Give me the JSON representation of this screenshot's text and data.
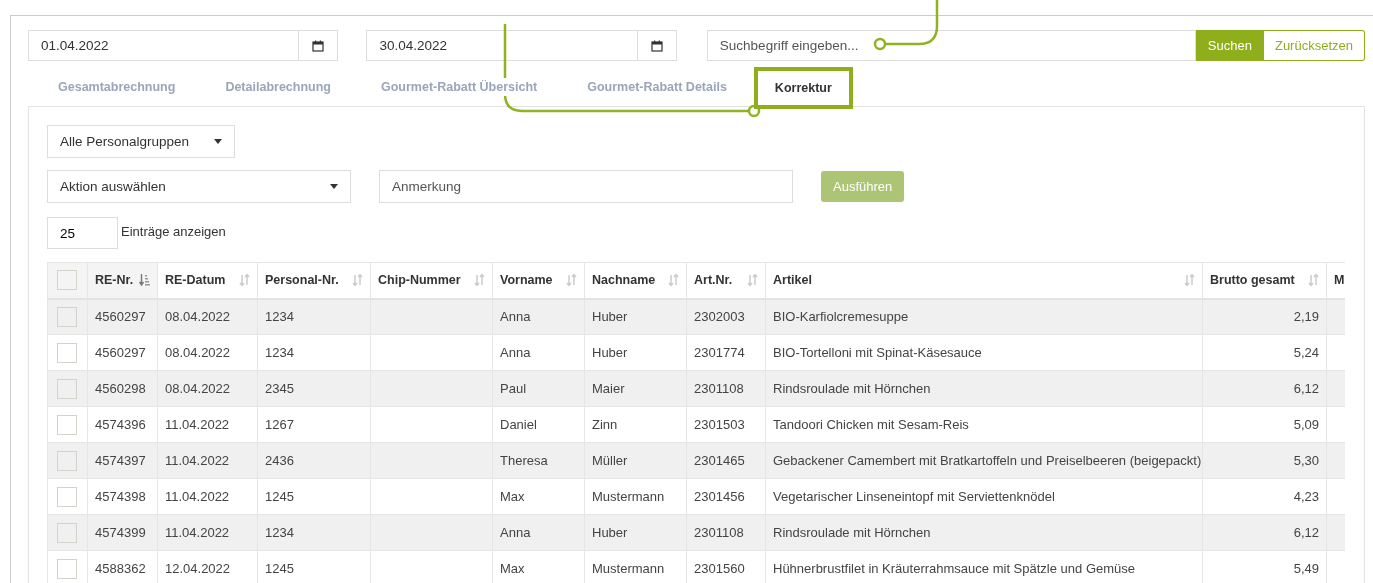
{
  "date_from": {
    "value": "01.04.2022"
  },
  "date_to": {
    "value": "30.04.2022"
  },
  "search": {
    "placeholder": "Suchbegriff eingeben..."
  },
  "search_buttons": [
    {
      "label": "Suchen",
      "kind": "primary"
    },
    {
      "label": "Zurücksetzen",
      "kind": "outline"
    }
  ],
  "tabs": [
    {
      "label": "Gesamtabrechnung",
      "selected": false,
      "highlighted": false
    },
    {
      "label": "Detailabrechnung",
      "selected": false,
      "highlighted": false
    },
    {
      "label": "Gourmet-Rabatt Übersicht",
      "selected": false,
      "highlighted": false
    },
    {
      "label": "Gourmet-Rabatt Details",
      "selected": false,
      "highlighted": false
    },
    {
      "label": "Korrektur",
      "selected": true,
      "highlighted": true
    }
  ],
  "group_select": {
    "value": "Alle Personalgruppen"
  },
  "action_select": {
    "value": "Aktion auswählen"
  },
  "remark": {
    "placeholder": "Anmerkung"
  },
  "run_button": {
    "label": "Ausführen",
    "disabled": true
  },
  "page_size": {
    "value": "25",
    "label": "Einträge anzeigen"
  },
  "table": {
    "columns": [
      {
        "label": "RE-Nr.",
        "sorted": true,
        "kind": "text"
      },
      {
        "label": "RE-Datum",
        "sorted": false,
        "kind": "text"
      },
      {
        "label": "Personal-Nr.",
        "sorted": false,
        "kind": "text"
      },
      {
        "label": "Chip-Nummer",
        "sorted": false,
        "kind": "text"
      },
      {
        "label": "Vorname",
        "sorted": false,
        "kind": "text"
      },
      {
        "label": "Nachname",
        "sorted": false,
        "kind": "text"
      },
      {
        "label": "Art.Nr.",
        "sorted": false,
        "kind": "text"
      },
      {
        "label": "Artikel",
        "sorted": false,
        "kind": "text"
      },
      {
        "label": "Brutto gesamt",
        "sorted": false,
        "kind": "amount"
      },
      {
        "label": "M",
        "kind": "cut"
      }
    ],
    "select_all": {
      "checked": false
    },
    "rows": [
      {
        "checked": false,
        "cells": [
          "4560297",
          "08.04.2022",
          "1234",
          "",
          "Anna",
          "Huber",
          "2302003",
          "BIO-Karfiolcremesuppe",
          "2,19",
          ""
        ]
      },
      {
        "checked": false,
        "cells": [
          "4560297",
          "08.04.2022",
          "1234",
          "",
          "Anna",
          "Huber",
          "2301774",
          "BIO-Tortelloni mit Spinat-Käsesauce",
          "5,24",
          ""
        ]
      },
      {
        "checked": false,
        "cells": [
          "4560298",
          "08.04.2022",
          "2345",
          "",
          "Paul",
          "Maier",
          "2301108",
          "Rindsroulade mit Hörnchen",
          "6,12",
          ""
        ]
      },
      {
        "checked": false,
        "cells": [
          "4574396",
          "11.04.2022",
          "1267",
          "",
          "Daniel",
          "Zinn",
          "2301503",
          "Tandoori Chicken mit Sesam-Reis",
          "5,09",
          ""
        ]
      },
      {
        "checked": false,
        "cells": [
          "4574397",
          "11.04.2022",
          "2436",
          "",
          "Theresa",
          "Müller",
          "2301465",
          "Gebackener Camembert mit Bratkartoffeln und Preiselbeeren (beigepackt)",
          "5,30",
          ""
        ]
      },
      {
        "checked": false,
        "cells": [
          "4574398",
          "11.04.2022",
          "1245",
          "",
          "Max",
          "Mustermann",
          "2301456",
          "Vegetarischer Linseneintopf mit Serviettenknödel",
          "4,23",
          ""
        ]
      },
      {
        "checked": false,
        "cells": [
          "4574399",
          "11.04.2022",
          "1234",
          "",
          "Anna",
          "Huber",
          "2301108",
          "Rindsroulade mit Hörnchen",
          "6,12",
          ""
        ]
      },
      {
        "checked": false,
        "cells": [
          "4588362",
          "12.04.2022",
          "1245",
          "",
          "Max",
          "Mustermann",
          "2301560",
          "Hühnerbrustfilet in Kräuterrahmsauce mit Spätzle und Gemüse",
          "5,49",
          ""
        ]
      }
    ]
  }
}
